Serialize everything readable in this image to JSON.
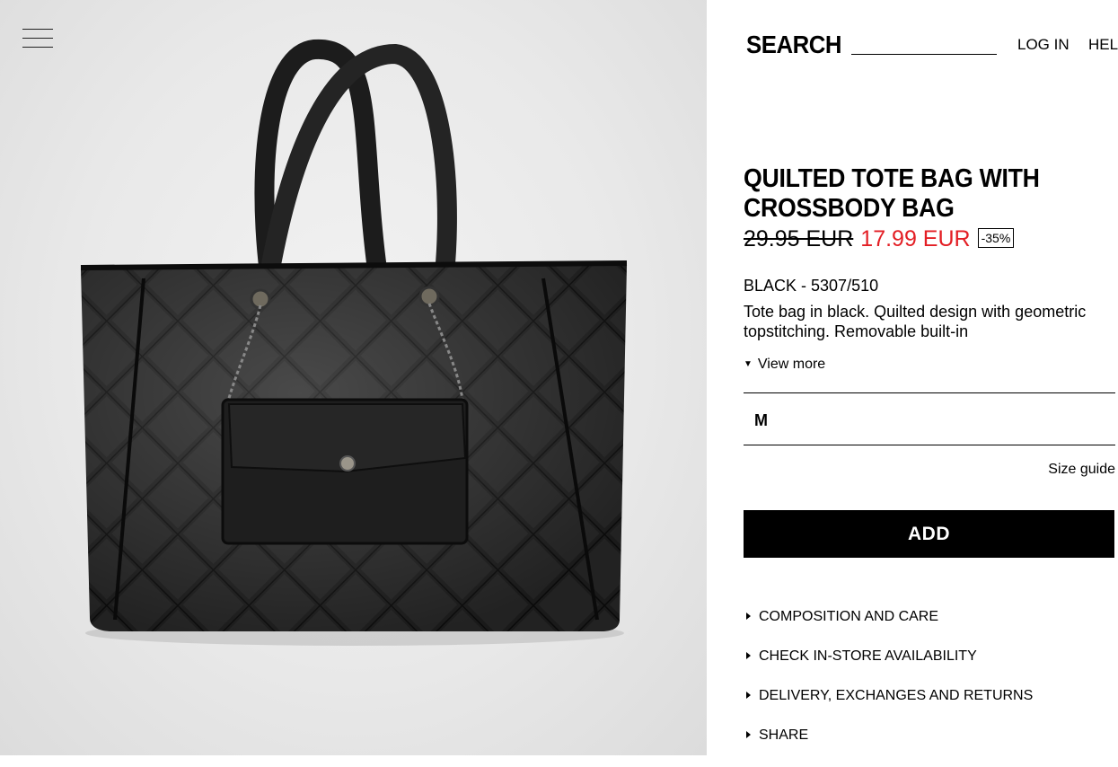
{
  "header": {
    "search_label": "SEARCH",
    "login_label": "LOG IN",
    "help_label": "HEL"
  },
  "product": {
    "title": "QUILTED TOTE BAG WITH CROSSBODY BAG",
    "old_price": "29.95 EUR",
    "new_price": "17.99 EUR",
    "discount": "-35%",
    "color_ref": "BLACK - 5307/510",
    "description": "Tote bag in black. Quilted design with geometric topstitching. Removable built-in",
    "view_more_label": "View more",
    "selected_size": "M",
    "size_guide_label": "Size guide",
    "add_label": "ADD",
    "accent_color": "#e31e24"
  },
  "info_links": [
    {
      "label": "COMPOSITION AND CARE"
    },
    {
      "label": "CHECK IN-STORE AVAILABILITY"
    },
    {
      "label": "DELIVERY, EXCHANGES AND RETURNS"
    },
    {
      "label": "SHARE"
    }
  ],
  "icons": [
    "menu-icon",
    "caret-down-icon",
    "caret-right-icon"
  ]
}
